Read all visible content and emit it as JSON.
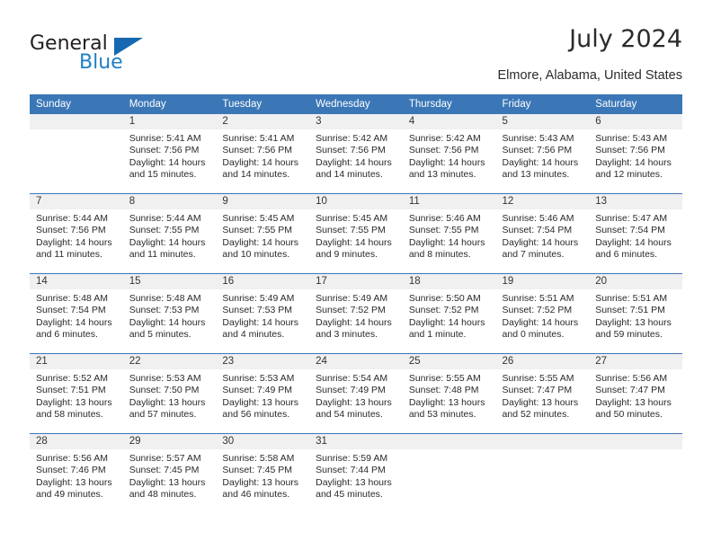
{
  "brand": {
    "name_part1": "General",
    "name_part2": "Blue",
    "accent_color": "#1f7fc4",
    "triangle_color": "#1668b0"
  },
  "header": {
    "title": "July 2024",
    "location": "Elmore, Alabama, United States",
    "header_bg": "#3b77b7"
  },
  "weekdays": [
    "Sunday",
    "Monday",
    "Tuesday",
    "Wednesday",
    "Thursday",
    "Friday",
    "Saturday"
  ],
  "labels": {
    "sunrise": "Sunrise:",
    "sunset": "Sunset:",
    "daylight": "Daylight:"
  },
  "weeks": [
    [
      {
        "day": "",
        "sunrise": "",
        "sunset": "",
        "daylight_line1": "",
        "daylight_line2": ""
      },
      {
        "day": "1",
        "sunrise": "Sunrise: 5:41 AM",
        "sunset": "Sunset: 7:56 PM",
        "daylight_line1": "Daylight: 14 hours",
        "daylight_line2": "and 15 minutes."
      },
      {
        "day": "2",
        "sunrise": "Sunrise: 5:41 AM",
        "sunset": "Sunset: 7:56 PM",
        "daylight_line1": "Daylight: 14 hours",
        "daylight_line2": "and 14 minutes."
      },
      {
        "day": "3",
        "sunrise": "Sunrise: 5:42 AM",
        "sunset": "Sunset: 7:56 PM",
        "daylight_line1": "Daylight: 14 hours",
        "daylight_line2": "and 14 minutes."
      },
      {
        "day": "4",
        "sunrise": "Sunrise: 5:42 AM",
        "sunset": "Sunset: 7:56 PM",
        "daylight_line1": "Daylight: 14 hours",
        "daylight_line2": "and 13 minutes."
      },
      {
        "day": "5",
        "sunrise": "Sunrise: 5:43 AM",
        "sunset": "Sunset: 7:56 PM",
        "daylight_line1": "Daylight: 14 hours",
        "daylight_line2": "and 13 minutes."
      },
      {
        "day": "6",
        "sunrise": "Sunrise: 5:43 AM",
        "sunset": "Sunset: 7:56 PM",
        "daylight_line1": "Daylight: 14 hours",
        "daylight_line2": "and 12 minutes."
      }
    ],
    [
      {
        "day": "7",
        "sunrise": "Sunrise: 5:44 AM",
        "sunset": "Sunset: 7:56 PM",
        "daylight_line1": "Daylight: 14 hours",
        "daylight_line2": "and 11 minutes."
      },
      {
        "day": "8",
        "sunrise": "Sunrise: 5:44 AM",
        "sunset": "Sunset: 7:55 PM",
        "daylight_line1": "Daylight: 14 hours",
        "daylight_line2": "and 11 minutes."
      },
      {
        "day": "9",
        "sunrise": "Sunrise: 5:45 AM",
        "sunset": "Sunset: 7:55 PM",
        "daylight_line1": "Daylight: 14 hours",
        "daylight_line2": "and 10 minutes."
      },
      {
        "day": "10",
        "sunrise": "Sunrise: 5:45 AM",
        "sunset": "Sunset: 7:55 PM",
        "daylight_line1": "Daylight: 14 hours",
        "daylight_line2": "and 9 minutes."
      },
      {
        "day": "11",
        "sunrise": "Sunrise: 5:46 AM",
        "sunset": "Sunset: 7:55 PM",
        "daylight_line1": "Daylight: 14 hours",
        "daylight_line2": "and 8 minutes."
      },
      {
        "day": "12",
        "sunrise": "Sunrise: 5:46 AM",
        "sunset": "Sunset: 7:54 PM",
        "daylight_line1": "Daylight: 14 hours",
        "daylight_line2": "and 7 minutes."
      },
      {
        "day": "13",
        "sunrise": "Sunrise: 5:47 AM",
        "sunset": "Sunset: 7:54 PM",
        "daylight_line1": "Daylight: 14 hours",
        "daylight_line2": "and 6 minutes."
      }
    ],
    [
      {
        "day": "14",
        "sunrise": "Sunrise: 5:48 AM",
        "sunset": "Sunset: 7:54 PM",
        "daylight_line1": "Daylight: 14 hours",
        "daylight_line2": "and 6 minutes."
      },
      {
        "day": "15",
        "sunrise": "Sunrise: 5:48 AM",
        "sunset": "Sunset: 7:53 PM",
        "daylight_line1": "Daylight: 14 hours",
        "daylight_line2": "and 5 minutes."
      },
      {
        "day": "16",
        "sunrise": "Sunrise: 5:49 AM",
        "sunset": "Sunset: 7:53 PM",
        "daylight_line1": "Daylight: 14 hours",
        "daylight_line2": "and 4 minutes."
      },
      {
        "day": "17",
        "sunrise": "Sunrise: 5:49 AM",
        "sunset": "Sunset: 7:52 PM",
        "daylight_line1": "Daylight: 14 hours",
        "daylight_line2": "and 3 minutes."
      },
      {
        "day": "18",
        "sunrise": "Sunrise: 5:50 AM",
        "sunset": "Sunset: 7:52 PM",
        "daylight_line1": "Daylight: 14 hours",
        "daylight_line2": "and 1 minute."
      },
      {
        "day": "19",
        "sunrise": "Sunrise: 5:51 AM",
        "sunset": "Sunset: 7:52 PM",
        "daylight_line1": "Daylight: 14 hours",
        "daylight_line2": "and 0 minutes."
      },
      {
        "day": "20",
        "sunrise": "Sunrise: 5:51 AM",
        "sunset": "Sunset: 7:51 PM",
        "daylight_line1": "Daylight: 13 hours",
        "daylight_line2": "and 59 minutes."
      }
    ],
    [
      {
        "day": "21",
        "sunrise": "Sunrise: 5:52 AM",
        "sunset": "Sunset: 7:51 PM",
        "daylight_line1": "Daylight: 13 hours",
        "daylight_line2": "and 58 minutes."
      },
      {
        "day": "22",
        "sunrise": "Sunrise: 5:53 AM",
        "sunset": "Sunset: 7:50 PM",
        "daylight_line1": "Daylight: 13 hours",
        "daylight_line2": "and 57 minutes."
      },
      {
        "day": "23",
        "sunrise": "Sunrise: 5:53 AM",
        "sunset": "Sunset: 7:49 PM",
        "daylight_line1": "Daylight: 13 hours",
        "daylight_line2": "and 56 minutes."
      },
      {
        "day": "24",
        "sunrise": "Sunrise: 5:54 AM",
        "sunset": "Sunset: 7:49 PM",
        "daylight_line1": "Daylight: 13 hours",
        "daylight_line2": "and 54 minutes."
      },
      {
        "day": "25",
        "sunrise": "Sunrise: 5:55 AM",
        "sunset": "Sunset: 7:48 PM",
        "daylight_line1": "Daylight: 13 hours",
        "daylight_line2": "and 53 minutes."
      },
      {
        "day": "26",
        "sunrise": "Sunrise: 5:55 AM",
        "sunset": "Sunset: 7:47 PM",
        "daylight_line1": "Daylight: 13 hours",
        "daylight_line2": "and 52 minutes."
      },
      {
        "day": "27",
        "sunrise": "Sunrise: 5:56 AM",
        "sunset": "Sunset: 7:47 PM",
        "daylight_line1": "Daylight: 13 hours",
        "daylight_line2": "and 50 minutes."
      }
    ],
    [
      {
        "day": "28",
        "sunrise": "Sunrise: 5:56 AM",
        "sunset": "Sunset: 7:46 PM",
        "daylight_line1": "Daylight: 13 hours",
        "daylight_line2": "and 49 minutes."
      },
      {
        "day": "29",
        "sunrise": "Sunrise: 5:57 AM",
        "sunset": "Sunset: 7:45 PM",
        "daylight_line1": "Daylight: 13 hours",
        "daylight_line2": "and 48 minutes."
      },
      {
        "day": "30",
        "sunrise": "Sunrise: 5:58 AM",
        "sunset": "Sunset: 7:45 PM",
        "daylight_line1": "Daylight: 13 hours",
        "daylight_line2": "and 46 minutes."
      },
      {
        "day": "31",
        "sunrise": "Sunrise: 5:59 AM",
        "sunset": "Sunset: 7:44 PM",
        "daylight_line1": "Daylight: 13 hours",
        "daylight_line2": "and 45 minutes."
      },
      {
        "day": "",
        "sunrise": "",
        "sunset": "",
        "daylight_line1": "",
        "daylight_line2": ""
      },
      {
        "day": "",
        "sunrise": "",
        "sunset": "",
        "daylight_line1": "",
        "daylight_line2": ""
      },
      {
        "day": "",
        "sunrise": "",
        "sunset": "",
        "daylight_line1": "",
        "daylight_line2": ""
      }
    ]
  ]
}
